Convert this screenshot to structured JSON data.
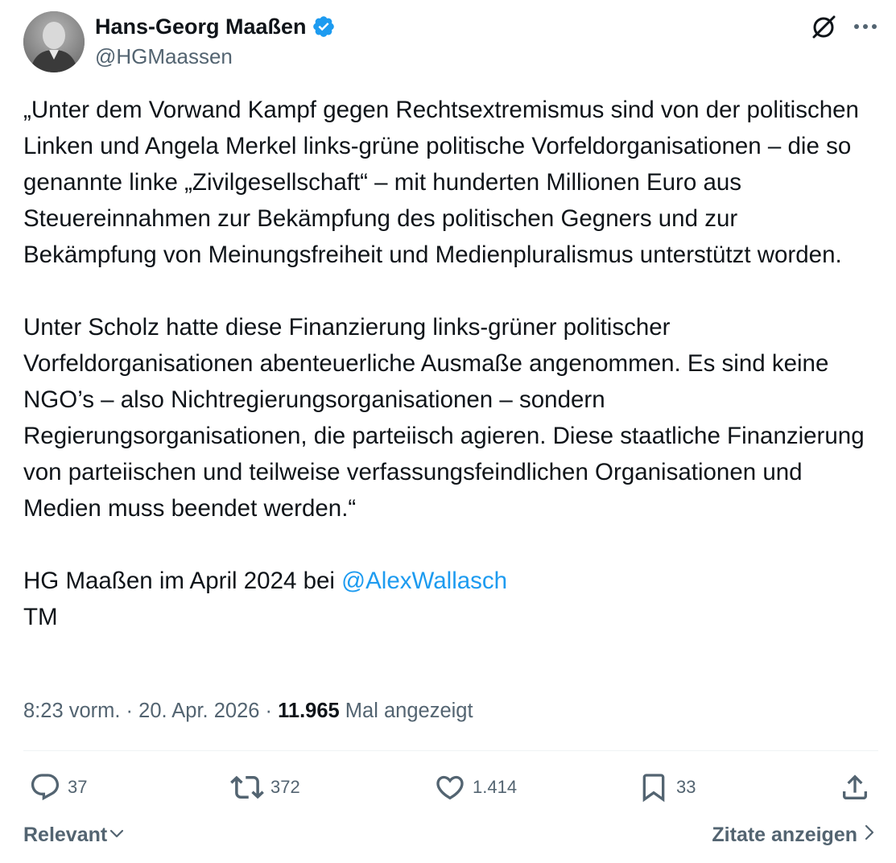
{
  "author": {
    "name": "Hans-Georg Maaßen",
    "handle": "@HGMaassen",
    "verified_color": "#1d9bf0"
  },
  "tweet": {
    "paragraph1": "„Unter dem Vorwand Kampf gegen Rechtsextremismus sind von der politischen Linken und Angela Merkel links-grüne politische Vorfeldorganisationen – die so genannte linke „Zivilgesellschaft“ – mit hunderten Millionen Euro aus Steuereinnahmen zur Bekämpfung des politischen Gegners und zur Bekämpfung von Meinungsfreiheit und Medienpluralismus unterstützt worden.",
    "paragraph2": "Unter Scholz hatte diese Finanzierung links-grüner politischer Vorfeldorganisationen abenteuerliche Ausmaße angenommen. Es sind keine NGO’s – also Nichtregierungsorganisationen – sondern Regierungsorganisationen, die parteiisch agieren. Diese staatliche Finanzierung von parteiischen und teilweise verfassungsfeindlichen Organisationen und Medien muss beendet werden.“",
    "attribution": "HG Maaßen im April 2024 bei ",
    "mention": "@AlexWallasch",
    "signature": "TM"
  },
  "meta": {
    "time": "8:23 vorm.",
    "separator": " · ",
    "date": "20. Apr. 2026",
    "views_count": "11.965",
    "views_label": " Mal angezeigt"
  },
  "actions": {
    "replies": "37",
    "reposts": "372",
    "likes": "1.414",
    "bookmarks": "33"
  },
  "footer": {
    "sort_label": "Relevant",
    "quotes_label": "Zitate anzeigen"
  },
  "icons": {
    "verified": "verified-badge-icon",
    "grok": "grok-icon",
    "more": "more-icon",
    "reply": "reply-icon",
    "repost": "repost-icon",
    "like": "heart-icon",
    "bookmark": "bookmark-icon",
    "share": "share-icon"
  },
  "colors": {
    "text": "#0f1419",
    "secondary": "#536471",
    "link": "#1d9bf0"
  }
}
